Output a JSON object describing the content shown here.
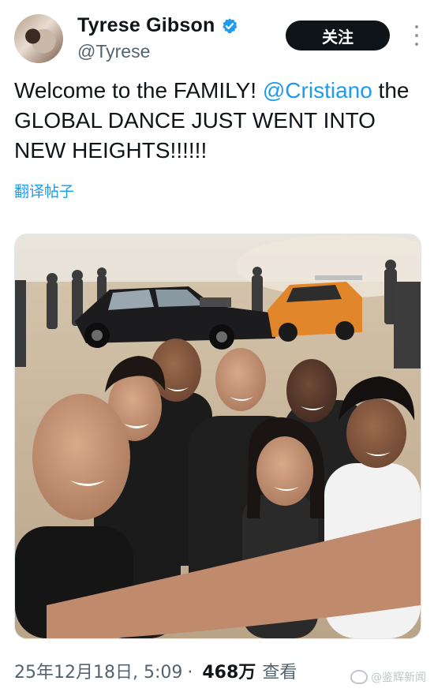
{
  "author": {
    "name": "Tyrese Gibson",
    "handle": "@Tyrese",
    "verified": true,
    "avatar_icon": "profile-photo"
  },
  "actions": {
    "follow_label": "关注",
    "more_icon": "more-vertical-icon"
  },
  "tweet": {
    "text_before": "Welcome to the FAMILY! ",
    "mention": "@Cristiano",
    "text_after": " the GLOBAL DANCE JUST WENT INTO NEW HEIGHTS!!!!!!",
    "translate_label": "翻译帖子"
  },
  "media": {
    "type": "photo",
    "icon": "group-selfie-photo"
  },
  "meta": {
    "date": "25年12月18日, 5:09",
    "separator": "·",
    "views_count": "468万",
    "views_label": "查看"
  },
  "watermark": {
    "text": "@鉴辉新闻"
  },
  "colors": {
    "link": "#1d9bf0",
    "text": "#0f1419",
    "muted": "#536471",
    "button_bg": "#0f1419"
  }
}
